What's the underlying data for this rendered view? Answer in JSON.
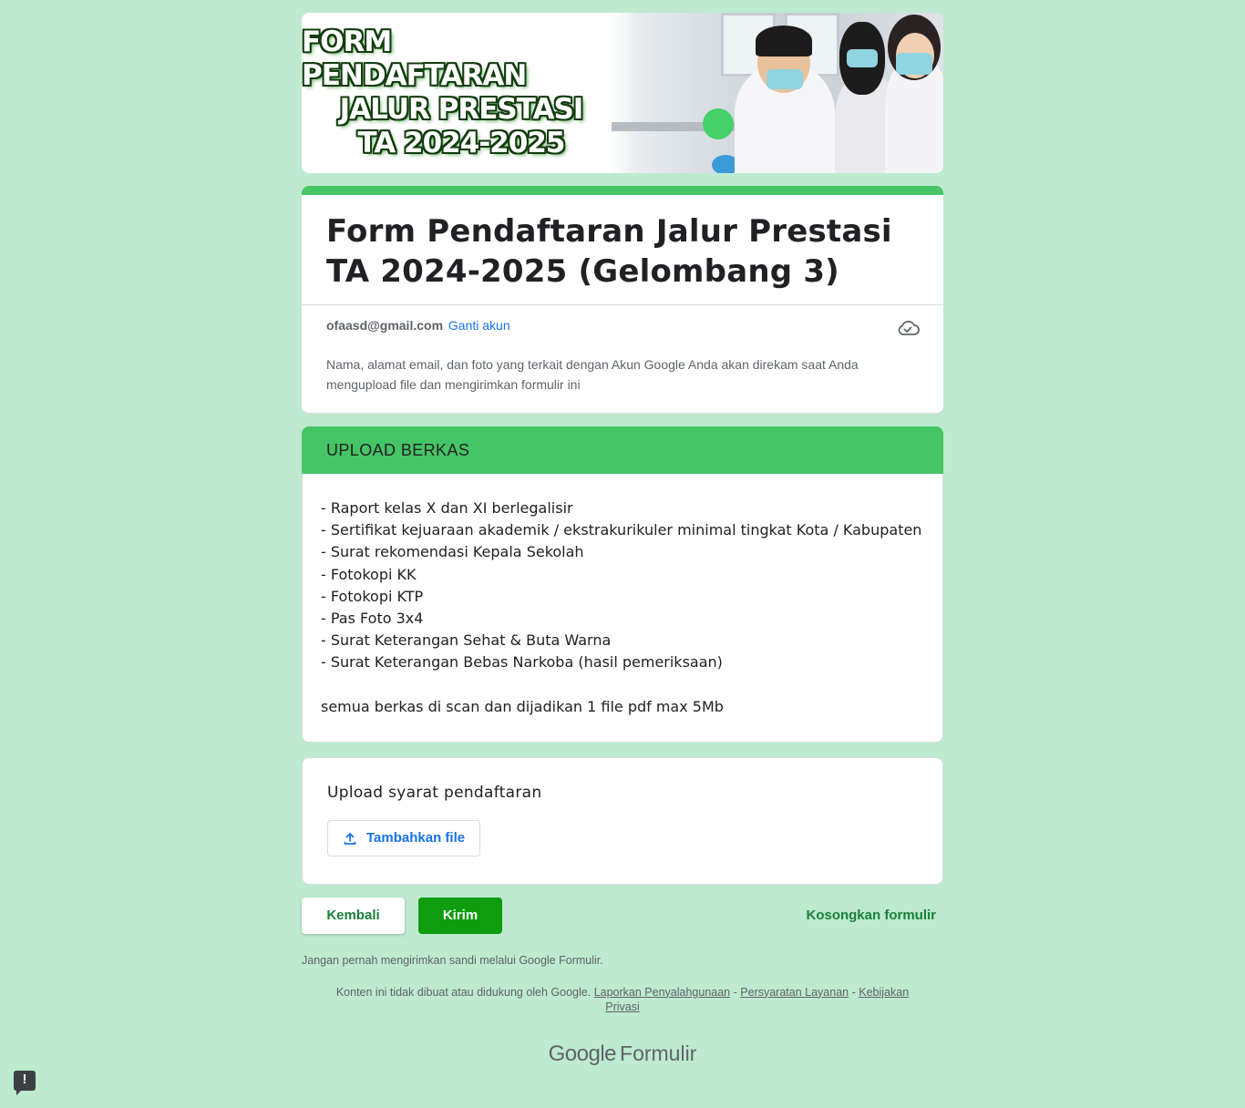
{
  "banner": {
    "lines": [
      "FORM PENDAFTARAN",
      "JALUR PRESTASI",
      "TA 2024-2025"
    ]
  },
  "form": {
    "title_line1": "Form Pendaftaran Jalur Prestasi",
    "title_line2": "TA 2024-2025 (Gelombang 3)"
  },
  "account": {
    "email": "ofaasd@gmail.com",
    "switch_label": "Ganti akun",
    "notice": "Nama, alamat email, dan foto yang terkait dengan Akun Google Anda akan direkam saat Anda mengupload file dan mengirimkan formulir ini"
  },
  "section": {
    "title": "UPLOAD BERKAS",
    "requirements": [
      "- Raport kelas X dan XI berlegalisir",
      "- Sertifikat kejuaraan akademik / ekstrakurikuler minimal tingkat Kota / Kabupaten",
      "- Surat rekomendasi Kepala Sekolah",
      "- Fotokopi KK",
      "- Fotokopi KTP",
      "- Pas Foto 3x4",
      "- Surat Keterangan Sehat & Buta Warna",
      "- Surat Keterangan Bebas Narkoba (hasil pemeriksaan)"
    ],
    "note": "semua berkas di scan dan dijadikan 1 file pdf max 5Mb"
  },
  "question": {
    "title": "Upload syarat pendaftaran",
    "upload_label": "Tambahkan file"
  },
  "nav": {
    "back_label": "Kembali",
    "submit_label": "Kirim",
    "clear_label": "Kosongkan formulir"
  },
  "footer": {
    "never_password": "Jangan pernah mengirimkan sandi melalui Google Formulir.",
    "disclaimer": "Konten ini tidak dibuat atau didukung oleh Google.",
    "link_abuse": "Laporkan Penyalahgunaan",
    "link_terms": "Persyaratan Layanan",
    "link_privacy": "Kebijakan Privasi",
    "separator": "-",
    "brand_google": "Google",
    "brand_forms": "Formulir"
  },
  "feedback": {
    "glyph": "!"
  },
  "colors": {
    "page_bg": "#beead0",
    "accent": "#45c565",
    "submit": "#0f9d0f",
    "link": "#1a73e8"
  }
}
